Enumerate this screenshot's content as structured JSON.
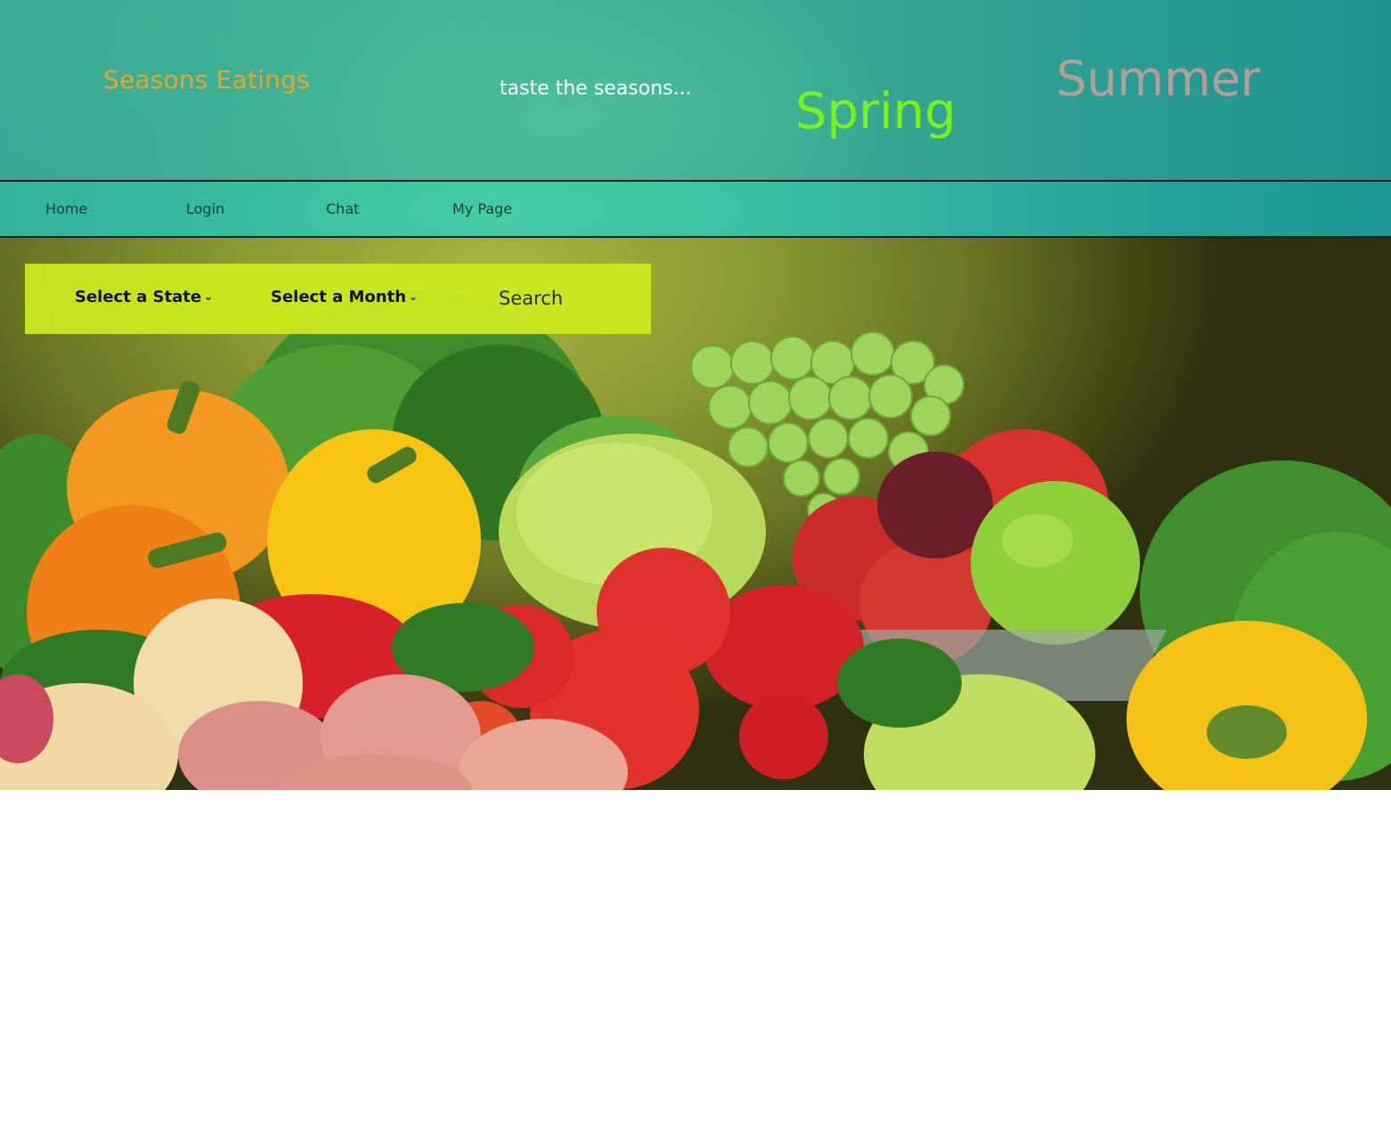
{
  "header": {
    "brand": "Seasons Eatings",
    "tagline": "taste the seasons...",
    "seasons": [
      "Spring",
      "Summer"
    ]
  },
  "nav": {
    "items": [
      "Home",
      "Login",
      "Chat",
      "My Page"
    ]
  },
  "filters": {
    "state_label": "Select a State",
    "month_label": "Select a Month",
    "search_placeholder": "Search"
  },
  "hero": {
    "image": "vegetables-and-fruit-display"
  },
  "colors": {
    "header_teal": "#35a894",
    "brand_orange": "#e8a52c",
    "spring_green": "#7cf21c",
    "summer_taupe": "#b59e97",
    "search_bar_lime": "#ceec1e"
  }
}
